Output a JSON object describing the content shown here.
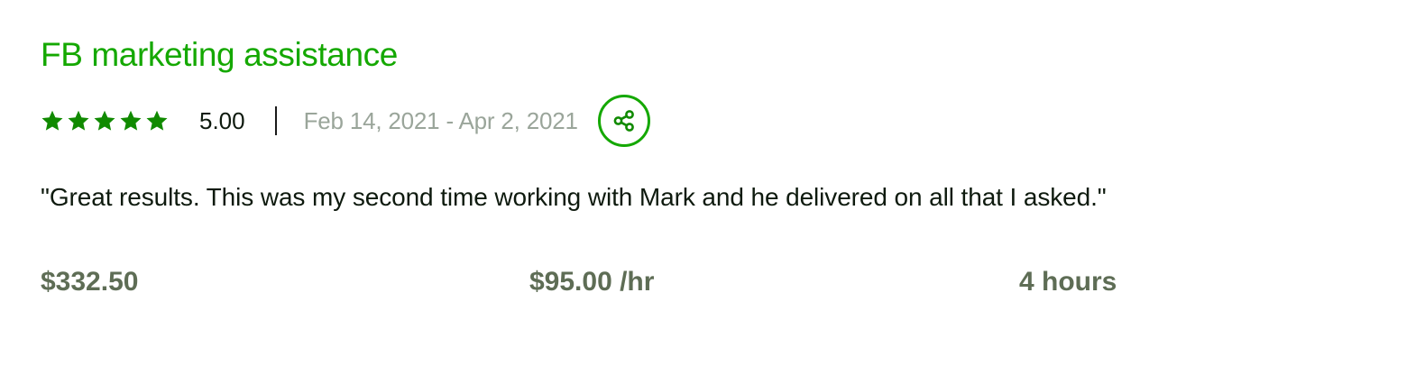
{
  "colors": {
    "accent": "#14a800",
    "star": "#108a00"
  },
  "job": {
    "title": "FB marketing assistance",
    "rating": {
      "stars": 5,
      "max_stars": 5,
      "score": "5.00"
    },
    "date_range": "Feb 14, 2021 - Apr 2, 2021",
    "share_icon": "share-icon",
    "feedback": "\"Great results. This was my second time working with Mark and he delivered on all that I asked.\"",
    "stats": {
      "total_earned": "$332.50",
      "hourly_rate": "$95.00 /hr",
      "hours": "4 hours"
    }
  }
}
